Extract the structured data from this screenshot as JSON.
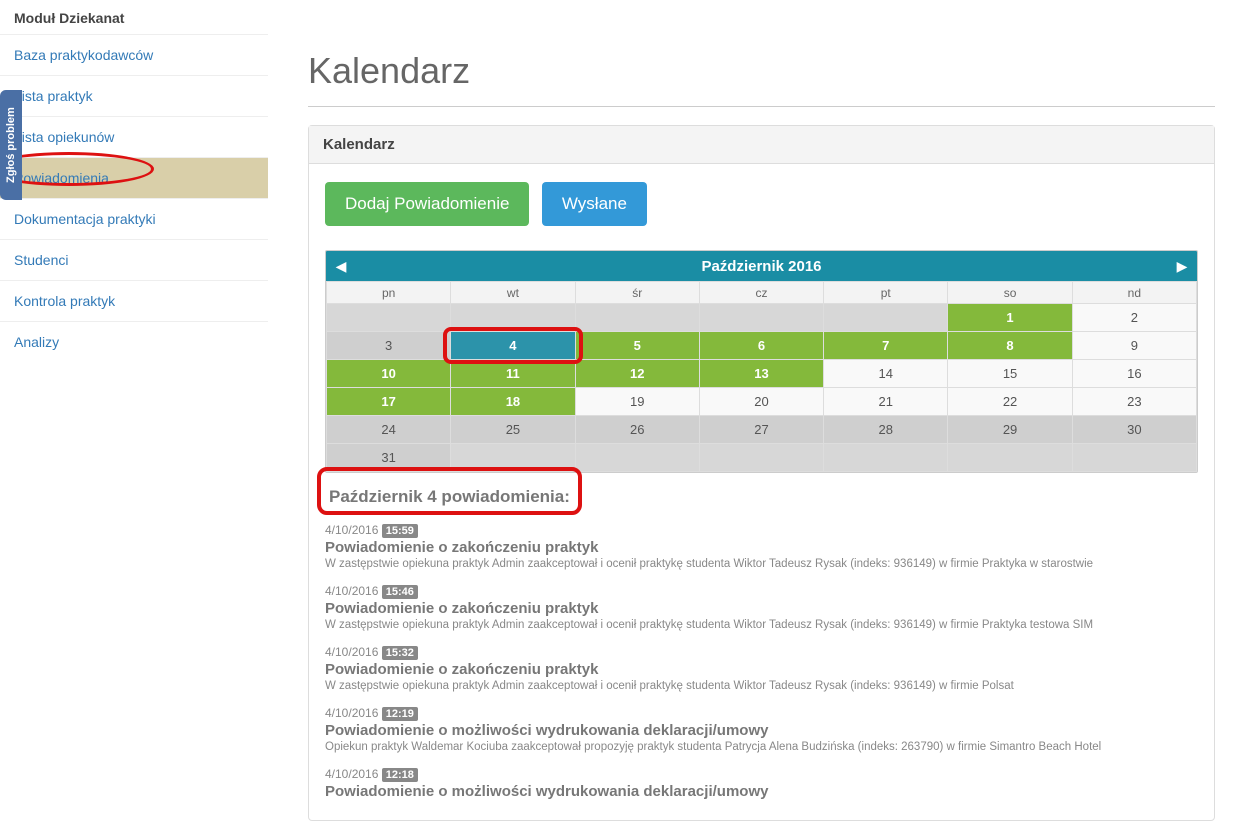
{
  "feedback_tab": "Zgłoś problem",
  "sidebar": {
    "title": "Moduł Dziekanat",
    "items": [
      {
        "label": "Baza praktykodawców",
        "active": false
      },
      {
        "label": "Lista praktyk",
        "active": false
      },
      {
        "label": "Lista opiekunów",
        "active": false
      },
      {
        "label": "Powiadomienia",
        "active": true,
        "circled": true
      },
      {
        "label": "Dokumentacja praktyki",
        "active": false
      },
      {
        "label": "Studenci",
        "active": false
      },
      {
        "label": "Kontrola praktyk",
        "active": false
      },
      {
        "label": "Analizy",
        "active": false
      }
    ]
  },
  "page": {
    "title": "Kalendarz",
    "panel_title": "Kalendarz",
    "btn_add": "Dodaj Powiadomienie",
    "btn_sent": "Wysłane"
  },
  "calendar": {
    "month_label": "Październik 2016",
    "weekdays": [
      "pn",
      "wt",
      "śr",
      "cz",
      "pt",
      "so",
      "nd"
    ],
    "rows": [
      [
        {
          "d": "",
          "t": "blank"
        },
        {
          "d": "",
          "t": "blank"
        },
        {
          "d": "",
          "t": "blank"
        },
        {
          "d": "",
          "t": "blank"
        },
        {
          "d": "",
          "t": "blank"
        },
        {
          "d": "1",
          "t": "green"
        },
        {
          "d": "2",
          "t": ""
        }
      ],
      [
        {
          "d": "3",
          "t": "grey"
        },
        {
          "d": "4",
          "t": "today"
        },
        {
          "d": "5",
          "t": "green"
        },
        {
          "d": "6",
          "t": "green"
        },
        {
          "d": "7",
          "t": "green"
        },
        {
          "d": "8",
          "t": "green"
        },
        {
          "d": "9",
          "t": ""
        }
      ],
      [
        {
          "d": "10",
          "t": "green"
        },
        {
          "d": "11",
          "t": "green"
        },
        {
          "d": "12",
          "t": "green"
        },
        {
          "d": "13",
          "t": "green"
        },
        {
          "d": "14",
          "t": ""
        },
        {
          "d": "15",
          "t": ""
        },
        {
          "d": "16",
          "t": ""
        }
      ],
      [
        {
          "d": "17",
          "t": "green"
        },
        {
          "d": "18",
          "t": "green"
        },
        {
          "d": "19",
          "t": ""
        },
        {
          "d": "20",
          "t": ""
        },
        {
          "d": "21",
          "t": ""
        },
        {
          "d": "22",
          "t": ""
        },
        {
          "d": "23",
          "t": ""
        }
      ],
      [
        {
          "d": "24",
          "t": "grey"
        },
        {
          "d": "25",
          "t": "grey"
        },
        {
          "d": "26",
          "t": "grey"
        },
        {
          "d": "27",
          "t": "grey"
        },
        {
          "d": "28",
          "t": "grey"
        },
        {
          "d": "29",
          "t": "grey"
        },
        {
          "d": "30",
          "t": "grey"
        }
      ],
      [
        {
          "d": "31",
          "t": "grey"
        },
        {
          "d": "",
          "t": "blank"
        },
        {
          "d": "",
          "t": "blank"
        },
        {
          "d": "",
          "t": "blank"
        },
        {
          "d": "",
          "t": "blank"
        },
        {
          "d": "",
          "t": "blank"
        },
        {
          "d": "",
          "t": "blank"
        }
      ]
    ]
  },
  "notifications": {
    "section": "Październik 4 powiadomienia:",
    "items": [
      {
        "date": "4/10/2016",
        "time": "15:59",
        "title": "Powiadomienie o zakończeniu praktyk",
        "desc": "W zastępstwie opiekuna praktyk Admin zaakceptował i ocenił praktykę studenta Wiktor Tadeusz Rysak (indeks: 936149) w firmie Praktyka w starostwie"
      },
      {
        "date": "4/10/2016",
        "time": "15:46",
        "title": "Powiadomienie o zakończeniu praktyk",
        "desc": "W zastępstwie opiekuna praktyk Admin zaakceptował i ocenił praktykę studenta Wiktor Tadeusz Rysak (indeks: 936149) w firmie Praktyka testowa SIM"
      },
      {
        "date": "4/10/2016",
        "time": "15:32",
        "title": "Powiadomienie o zakończeniu praktyk",
        "desc": "W zastępstwie opiekuna praktyk Admin zaakceptował i ocenił praktykę studenta Wiktor Tadeusz Rysak (indeks: 936149) w firmie Polsat"
      },
      {
        "date": "4/10/2016",
        "time": "12:19",
        "title": "Powiadomienie o możliwości wydrukowania deklaracji/umowy",
        "desc": "Opiekun praktyk Waldemar Kociuba zaakceptował propozyję praktyk studenta Patrycja Alena Budzińska (indeks: 263790) w firmie Simantro Beach Hotel"
      },
      {
        "date": "4/10/2016",
        "time": "12:18",
        "title": "Powiadomienie o możliwości wydrukowania deklaracji/umowy",
        "desc": ""
      }
    ]
  }
}
